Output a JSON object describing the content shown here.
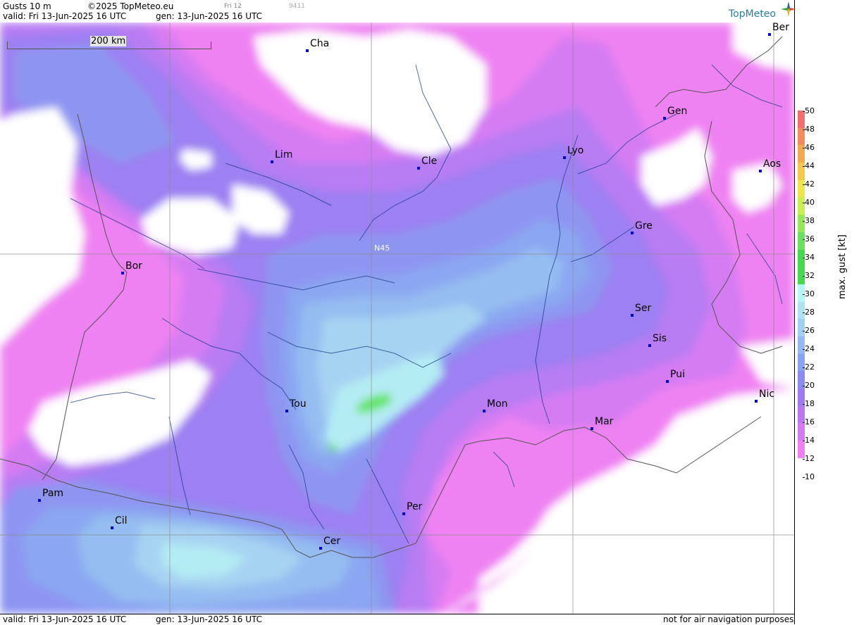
{
  "header": {
    "product": "Gusts 10 m",
    "copyright": "©2025 TopMeteo.eu",
    "valid": "valid:  Fri  13-Jun-2025  16 UTC",
    "gen": "gen: 13-Jun-2025 16 UTC",
    "frame": "Fri 12",
    "code": "9411"
  },
  "footer": {
    "valid": "valid:  Fri  13-Jun-2025  16 UTC",
    "gen": "gen: 13-Jun-2025 16 UTC",
    "disclaimer": "not for air navigation purposes"
  },
  "logo": "TopMeteo",
  "map": {
    "scale_label": "200 km",
    "grid_label": "N45",
    "cities": [
      {
        "label": "Cha"
      },
      {
        "label": "Ber"
      },
      {
        "label": "Gen"
      },
      {
        "label": "Lim"
      },
      {
        "label": "Cle"
      },
      {
        "label": "Lyo"
      },
      {
        "label": "Aos"
      },
      {
        "label": "Gre"
      },
      {
        "label": "Bor"
      },
      {
        "label": "Ser"
      },
      {
        "label": "Sis"
      },
      {
        "label": "Pui"
      },
      {
        "label": "Tou"
      },
      {
        "label": "Mon"
      },
      {
        "label": "Mar"
      },
      {
        "label": "Nic"
      },
      {
        "label": "Pam"
      },
      {
        "label": "Cil"
      },
      {
        "label": "Per"
      },
      {
        "label": "Cer"
      }
    ]
  },
  "legend": {
    "title": "max. gust  [kt]",
    "ticks": [
      "50",
      "48",
      "46",
      "44",
      "42",
      "40",
      "38",
      "36",
      "34",
      "32",
      "30",
      "28",
      "26",
      "24",
      "22",
      "20",
      "18",
      "16",
      "14",
      "12",
      "10"
    ],
    "colors": [
      "#f07070",
      "#f08d5e",
      "#f0aa50",
      "#f2c94e",
      "#ede64e",
      "#c9ed55",
      "#96e65a",
      "#6be060",
      "#47d84f",
      "#47d84f",
      "#b5f7f7",
      "#aee2f0",
      "#a2d0f0",
      "#95b9f0",
      "#8aa2f0",
      "#8b8bf0",
      "#9c7cf0",
      "#b978f0",
      "#d67af0",
      "#ee80f0"
    ]
  },
  "palette": {
    "p12": "#ef82f2",
    "p14": "#d57bf3",
    "p16": "#b87bf3",
    "p18": "#9d80f2",
    "p20": "#8e95f1",
    "p22": "#8ba7f1",
    "p24": "#95bdf1",
    "p26": "#a7d3f2",
    "p28": "#b4ecf4",
    "p30": "#5fe45a",
    "grid": "#8c8c8c",
    "river": "#1e3a8a",
    "border": "#555555"
  }
}
